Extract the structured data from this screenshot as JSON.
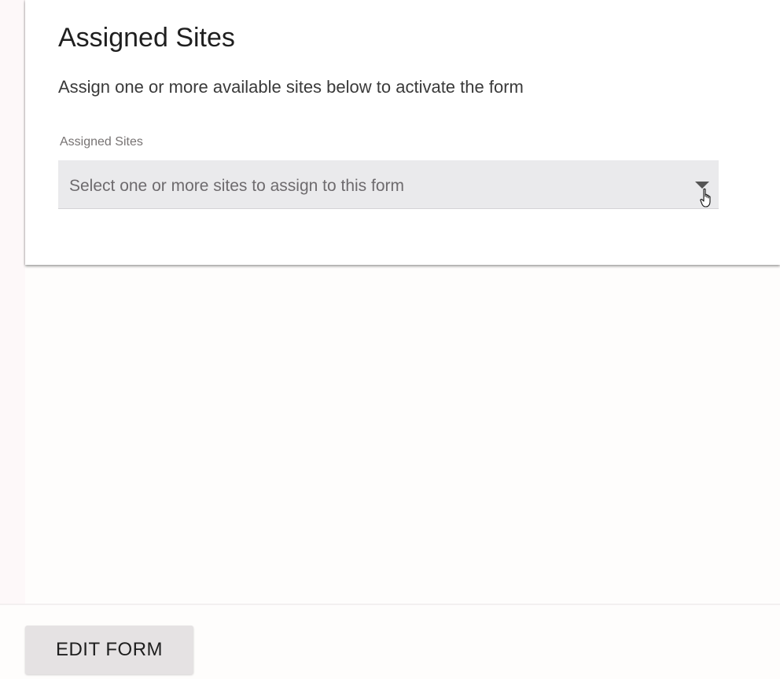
{
  "card": {
    "title": "Assigned Sites",
    "subtitle": "Assign one or more available sites below to activate the form",
    "field": {
      "label": "Assigned Sites",
      "placeholder": "Select one or more sites to assign to this form",
      "icon": "caret-down-icon"
    }
  },
  "footer": {
    "edit_button_label": "EDIT FORM"
  },
  "colors": {
    "field_background": "#eaeaec",
    "button_background": "#e5e2e3",
    "page_background": "#fefdfc"
  }
}
